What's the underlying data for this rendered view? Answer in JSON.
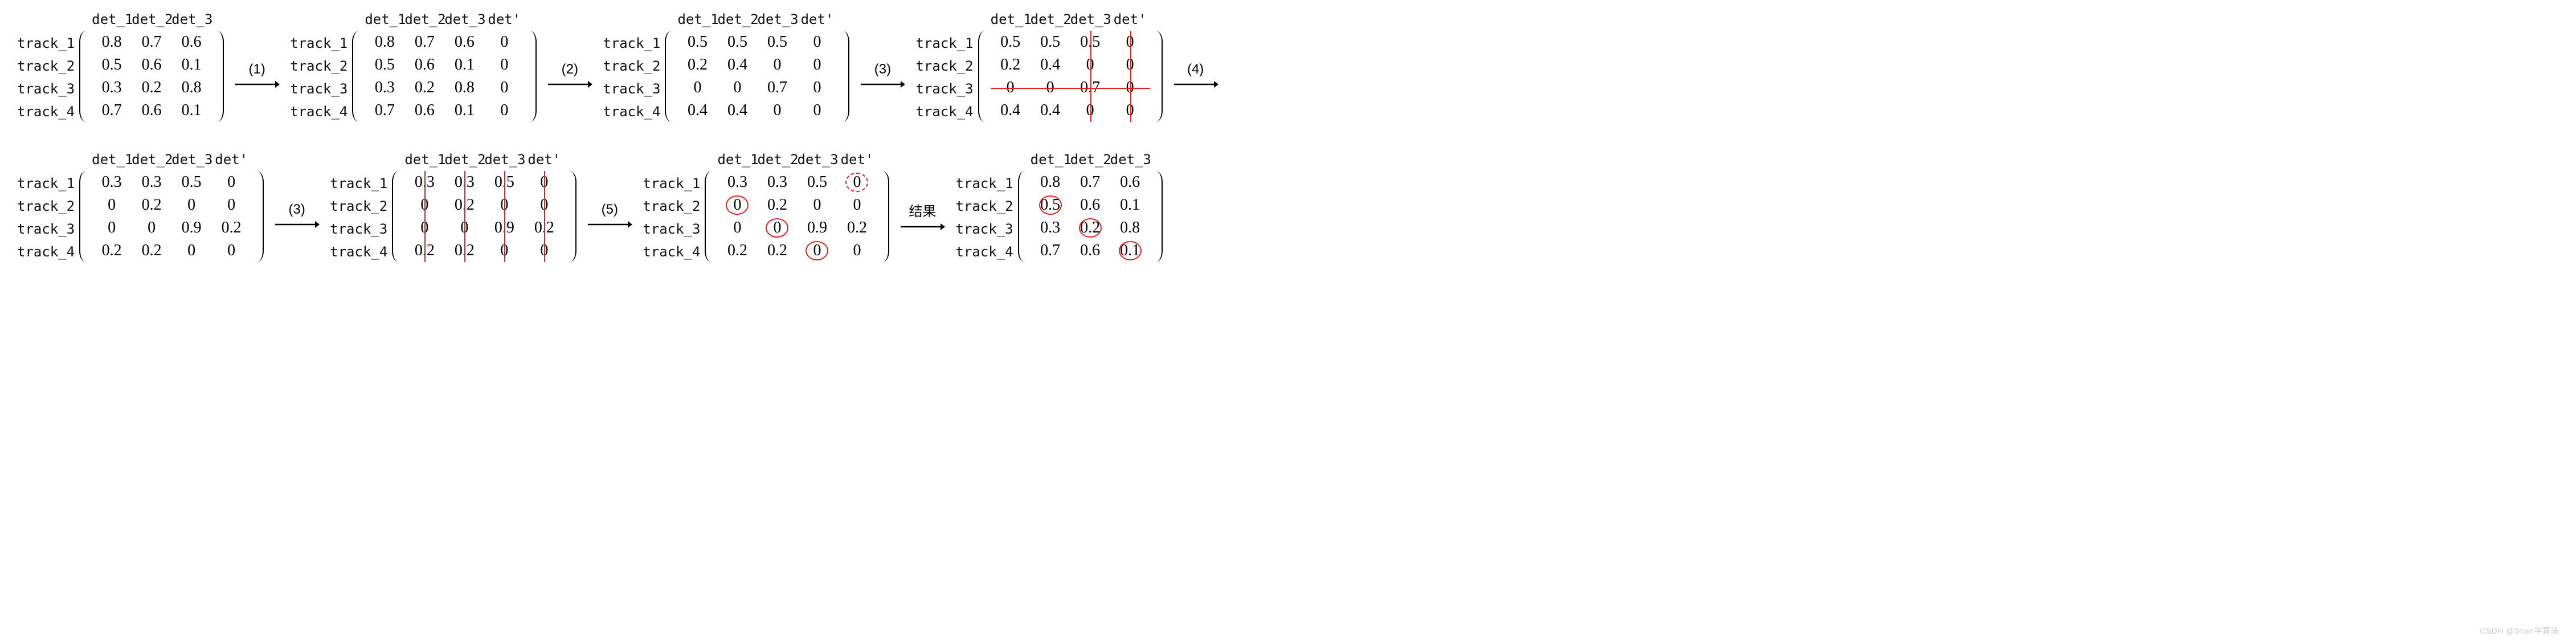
{
  "rowLabels": [
    "track_1",
    "track_2",
    "track_3",
    "track_4"
  ],
  "colLabels3": [
    "det_1",
    "det_2",
    "det_3"
  ],
  "colLabels4": [
    "det_1",
    "det_2",
    "det_3",
    "det'"
  ],
  "arrows": [
    "(1)",
    "(2)",
    "(3)",
    "(4)",
    "(3)",
    "(5)",
    "结果"
  ],
  "watermark": "CSDN @Shan学算法",
  "matrices": {
    "m1": [
      [
        "0.8",
        "0.7",
        "0.6"
      ],
      [
        "0.5",
        "0.6",
        "0.1"
      ],
      [
        "0.3",
        "0.2",
        "0.8"
      ],
      [
        "0.7",
        "0.6",
        "0.1"
      ]
    ],
    "m2": [
      [
        "0.8",
        "0.7",
        "0.6",
        "0"
      ],
      [
        "0.5",
        "0.6",
        "0.1",
        "0"
      ],
      [
        "0.3",
        "0.2",
        "0.8",
        "0"
      ],
      [
        "0.7",
        "0.6",
        "0.1",
        "0"
      ]
    ],
    "m3": [
      [
        "0.5",
        "0.5",
        "0.5",
        "0"
      ],
      [
        "0.2",
        "0.4",
        "0",
        "0"
      ],
      [
        "0",
        "0",
        "0.7",
        "0"
      ],
      [
        "0.4",
        "0.4",
        "0",
        "0"
      ]
    ],
    "m4": [
      [
        "0.5",
        "0.5",
        "0.5",
        "0"
      ],
      [
        "0.2",
        "0.4",
        "0",
        "0"
      ],
      [
        "0",
        "0",
        "0.7",
        "0"
      ],
      [
        "0.4",
        "0.4",
        "0",
        "0"
      ]
    ],
    "m5": [
      [
        "0.3",
        "0.3",
        "0.5",
        "0"
      ],
      [
        "0",
        "0.2",
        "0",
        "0"
      ],
      [
        "0",
        "0",
        "0.9",
        "0.2"
      ],
      [
        "0.2",
        "0.2",
        "0",
        "0"
      ]
    ],
    "m6": [
      [
        "0.3",
        "0.3",
        "0.5",
        "0"
      ],
      [
        "0",
        "0.2",
        "0",
        "0"
      ],
      [
        "0",
        "0",
        "0.9",
        "0.2"
      ],
      [
        "0.2",
        "0.2",
        "0",
        "0"
      ]
    ],
    "m7": [
      [
        "0.3",
        "0.3",
        "0.5",
        "0"
      ],
      [
        "0",
        "0.2",
        "0",
        "0"
      ],
      [
        "0",
        "0",
        "0.9",
        "0.2"
      ],
      [
        "0.2",
        "0.2",
        "0",
        "0"
      ]
    ],
    "m8": [
      [
        "0.8",
        "0.7",
        "0.6"
      ],
      [
        "0.5",
        "0.6",
        "0.1"
      ],
      [
        "0.3",
        "0.2",
        "0.8"
      ],
      [
        "0.7",
        "0.6",
        "0.1"
      ]
    ]
  },
  "config": {
    "m1": {
      "cols": "colLabels3"
    },
    "m2": {
      "cols": "colLabels4"
    },
    "m3": {
      "cols": "colLabels4"
    },
    "m4": {
      "cols": "colLabels4",
      "vlines": [
        2,
        3
      ],
      "hlines": [
        2
      ]
    },
    "m5": {
      "cols": "colLabels4"
    },
    "m6": {
      "cols": "colLabels4",
      "vlines": [
        0,
        1,
        2,
        3
      ]
    },
    "m7": {
      "cols": "colLabels4",
      "circles": [
        [
          1,
          0
        ],
        [
          2,
          1
        ],
        [
          3,
          2
        ]
      ],
      "dashedCircles": [
        [
          0,
          3
        ]
      ]
    },
    "m8": {
      "cols": "colLabels3",
      "circles": [
        [
          1,
          0
        ],
        [
          2,
          1
        ],
        [
          3,
          2
        ]
      ]
    }
  },
  "layout": {
    "row1": [
      "m1",
      "a0",
      "m2",
      "a1",
      "m3",
      "a2",
      "m4",
      "a3"
    ],
    "row2": [
      "m5",
      "a4",
      "m6",
      "a5",
      "m7",
      "a6",
      "m8"
    ]
  }
}
